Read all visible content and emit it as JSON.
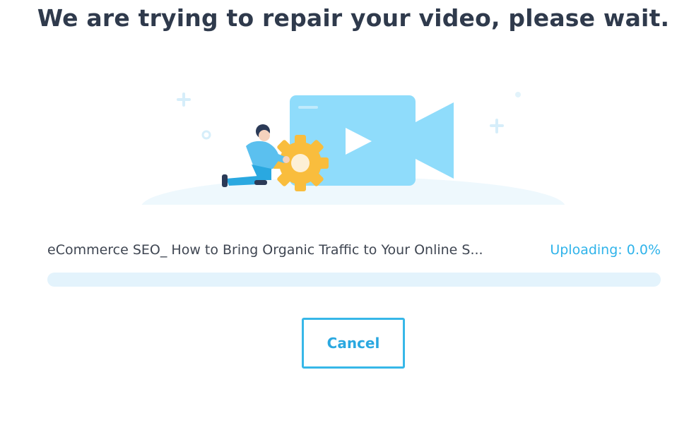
{
  "dialog": {
    "title": "We are trying to repair your video, please wait.",
    "file_name": "eCommerce SEO_ How to Bring Organic Traffic to Your Online S...",
    "status_text": "Uploading: 0.0%",
    "progress_fraction": 0.0,
    "cancel_label": "Cancel"
  },
  "illustration": {
    "icon": "video-repair-illustration"
  },
  "colors": {
    "title": "#2f3a4c",
    "accent": "#2fb3ea",
    "progress_track": "#e3f3fc",
    "gear": "#f9bd3d",
    "camera": "#8fdcfb"
  }
}
